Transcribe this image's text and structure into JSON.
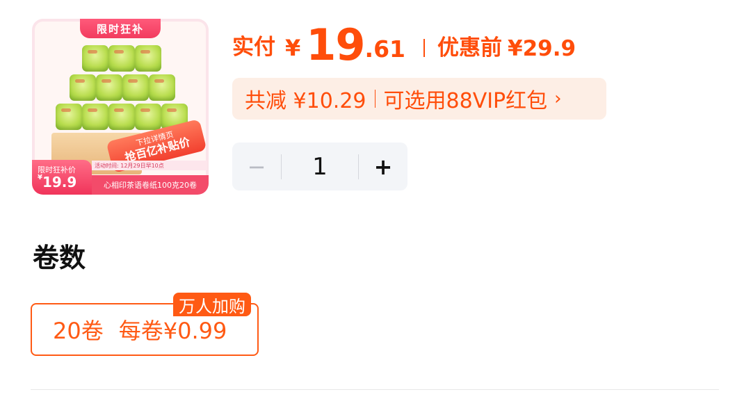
{
  "product_image": {
    "promo_tab": "限时狂补",
    "sticker_top": "下拉详情页",
    "sticker_main": "抢百亿补贴价",
    "event_text": "活动时间: 12月29日早10点",
    "tag_label": "限时狂补价",
    "tag_currency": "¥",
    "tag_price": "19.9",
    "name": "心相印茶语卷纸100克20卷"
  },
  "price": {
    "paid_label": "实付",
    "currency": "¥",
    "integer": "19",
    "decimal": ".61",
    "before_label": "优惠前",
    "before_value": "¥29.9"
  },
  "discount": {
    "total": "共减 ¥10.29",
    "vip": "可选用88VIP红包",
    "chevron": "›"
  },
  "quantity": {
    "minus": "−",
    "value": "1",
    "plus": "+"
  },
  "spec": {
    "title": "卷数",
    "option_rolls": "20卷",
    "option_per": "每卷¥0.99",
    "badge": "万人加购"
  },
  "colors": {
    "accent": "#ff4d0a",
    "promo_pink": "#f23b5f",
    "pill_bg": "#fdeee5",
    "stepper_bg": "#f3f5f8"
  }
}
